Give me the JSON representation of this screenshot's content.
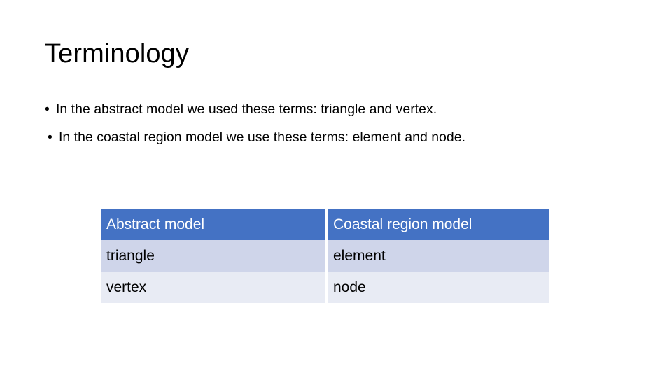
{
  "slide": {
    "title": "Terminology",
    "bullets": [
      {
        "marker": "•",
        "text": "In the abstract model we used these terms: triangle and vertex."
      },
      {
        "marker": "•",
        "text": "In the coastal region model we use these terms: element and node."
      }
    ],
    "table": {
      "headers": [
        "Abstract model",
        "Coastal region model"
      ],
      "rows": [
        [
          "triangle",
          "element"
        ],
        [
          "vertex",
          "node"
        ]
      ],
      "colors": {
        "header_fill": "#4472C4",
        "header_text": "#FFFFFF",
        "row_odd_fill": "#CFD5EA",
        "row_even_fill": "#E8EBF4",
        "body_text": "#000000"
      }
    },
    "background": "#FFFFFF"
  }
}
